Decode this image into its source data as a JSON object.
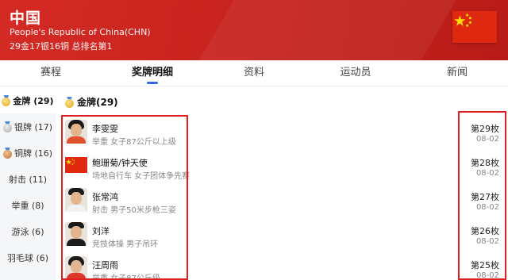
{
  "header": {
    "title": "中国",
    "subtitle": "People's Republic of China(CHN)",
    "summary": "29金17银16铜 总排名第1",
    "flag_color": "#de2910",
    "star_color": "#ffde00"
  },
  "tabs": [
    {
      "label": "赛程"
    },
    {
      "label": "奖牌明细"
    },
    {
      "label": "资料"
    },
    {
      "label": "运动员"
    },
    {
      "label": "新闻"
    }
  ],
  "active_tab": "奖牌明细",
  "accent_color": "#2e6be6",
  "sidebar": {
    "items": [
      {
        "label": "金牌 (29)",
        "icon": "gold-medal-icon"
      },
      {
        "label": "银牌 (17)",
        "icon": "silver-medal-icon"
      },
      {
        "label": "铜牌 (16)",
        "icon": "bronze-medal-icon"
      },
      {
        "label": "射击 (11)"
      },
      {
        "label": "举重 (8)"
      },
      {
        "label": "游泳 (6)"
      },
      {
        "label": "羽毛球 (6)"
      }
    ]
  },
  "section": {
    "title": "金牌(29)",
    "icon": "gold-medal-icon"
  },
  "highlight_color": "#e02020",
  "medals": [
    {
      "name": "李雯雯",
      "event": "举重 女子87公斤以上级",
      "rank": "第29枚",
      "date": "08-02",
      "avatar": "athlete-photo"
    },
    {
      "name": "鲍珊菊/钟天使",
      "event": "场地自行车 女子团体争先赛",
      "rank": "第28枚",
      "date": "08-02",
      "avatar": "china-flag"
    },
    {
      "name": "张常鸿",
      "event": "射击 男子50米步枪三姿",
      "rank": "第27枚",
      "date": "08-02",
      "avatar": "athlete-photo"
    },
    {
      "name": "刘洋",
      "event": "竞技体操 男子吊环",
      "rank": "第26枚",
      "date": "08-02",
      "avatar": "athlete-photo"
    },
    {
      "name": "汪周雨",
      "event": "举重 女子87公斤级",
      "rank": "第25枚",
      "date": "08-02",
      "avatar": "athlete-photo"
    }
  ]
}
